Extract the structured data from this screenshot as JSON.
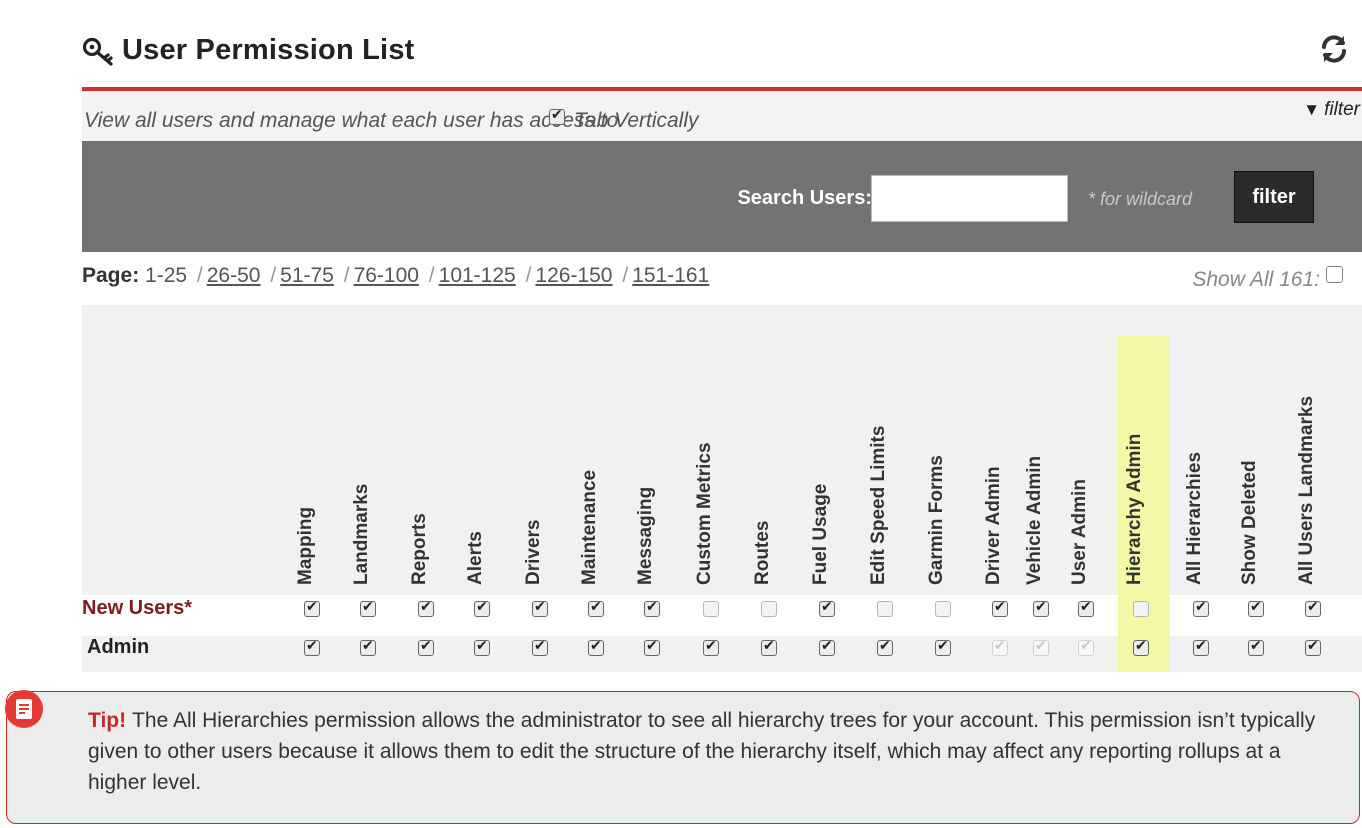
{
  "header": {
    "title": "User Permission List",
    "title_icon": "key-icon",
    "refresh_icon": "refresh-icon"
  },
  "subheader": {
    "description": "View all users and manage what each user has access to.",
    "tab_vertically_label": "Tab Vertically",
    "tab_vertically_checked": true,
    "filter_label": "filter",
    "filter_icon": "funnel-icon"
  },
  "search": {
    "label": "Search Users:",
    "value": "",
    "hint": "* for wildcard",
    "button_label": "filter"
  },
  "pagination": {
    "label": "Page:",
    "current": "1-25",
    "pages": [
      "26-50",
      "51-75",
      "76-100",
      "101-125",
      "126-150",
      "151-161"
    ],
    "show_all_label": "Show All 161:",
    "show_all_checked": false
  },
  "columns": [
    "Mapping",
    "Landmarks",
    "Reports",
    "Alerts",
    "Drivers",
    "Maintenance",
    "Messaging",
    "Custom Metrics",
    "Routes",
    "Fuel Usage",
    "Edit Speed Limits",
    "Garmin Forms",
    "Driver Admin",
    "Vehicle Admin",
    "User Admin",
    "Hierarchy Admin",
    "All Hierarchies",
    "Show Deleted",
    "All Users Landmarks"
  ],
  "highlighted_column": "Hierarchy Admin",
  "rows": [
    {
      "name": "New Users*",
      "name_color": "#7a1f1f",
      "states": [
        "on",
        "on",
        "on",
        "on",
        "on",
        "on",
        "on",
        "off",
        "off",
        "on",
        "off",
        "off",
        "on",
        "on",
        "on",
        "off",
        "on",
        "on",
        "on"
      ]
    },
    {
      "name": "Admin",
      "name_color": "#222222",
      "states": [
        "on",
        "on",
        "on",
        "on",
        "on",
        "on",
        "on",
        "on",
        "on",
        "on",
        "on",
        "on",
        "dis",
        "dis",
        "dis",
        "on",
        "on",
        "on",
        "on"
      ]
    }
  ],
  "tip": {
    "heading": "Tip!",
    "body": "The All Hierarchies permission allows the administrator to see all hierarchy trees for your account. This permission isn’t typically given to other users because it allows them to edit the structure of the hierarchy itself, which may affect any reporting rollups at a higher level.",
    "icon": "note-icon"
  },
  "colors": {
    "accent_red": "#d32f2f",
    "band_gray": "#737373",
    "highlight_yellow": "#f4f7a6"
  }
}
